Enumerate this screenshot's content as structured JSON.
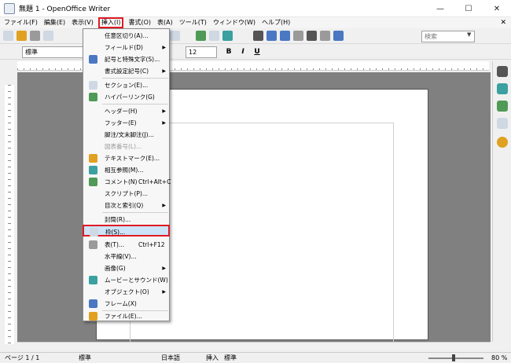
{
  "window": {
    "title": "無題 1 - OpenOffice Writer",
    "minimize": "—",
    "maximize": "☐",
    "close": "✕"
  },
  "menubar": {
    "items": [
      {
        "label": "ファイル(F)"
      },
      {
        "label": "編集(E)"
      },
      {
        "label": "表示(V)"
      },
      {
        "label": "挿入(I)",
        "active": true
      },
      {
        "label": "書式(O)"
      },
      {
        "label": "表(A)"
      },
      {
        "label": "ツール(T)"
      },
      {
        "label": "ウィンドウ(W)"
      },
      {
        "label": "ヘルプ(H)"
      }
    ],
    "close": "✕"
  },
  "toolbar": {
    "search_placeholder": "検索"
  },
  "formatting": {
    "paragraph_style": "標準",
    "font_size": "12",
    "bold": "B",
    "italic": "I",
    "underline": "U"
  },
  "insert_menu": {
    "items": [
      {
        "label": "任意区切り(A)..."
      },
      {
        "label": "フィールド(D)",
        "submenu": true
      },
      {
        "label": "記号と特殊文字(S)...",
        "icon": "special-character-icon"
      },
      {
        "label": "書式設定記号(C)",
        "submenu": true
      },
      {
        "label": "セクション(E)...",
        "icon": "section-icon"
      },
      {
        "label": "ハイパーリンク(G)",
        "icon": "hyperlink-icon"
      },
      {
        "label": "ヘッダー(H)",
        "submenu": true
      },
      {
        "label": "フッター(E)",
        "submenu": true
      },
      {
        "label": "脚注/文末脚注(J)..."
      },
      {
        "label": "図表番号(L)...",
        "disabled": true
      },
      {
        "label": "テキストマーク(E)...",
        "icon": "bookmark-icon"
      },
      {
        "label": "相互参照(M)...",
        "icon": "cross-reference-icon"
      },
      {
        "label": "コメント(N)",
        "shortcut": "Ctrl+Alt+C",
        "icon": "comment-icon"
      },
      {
        "label": "スクリプト(P)..."
      },
      {
        "label": "目次と索引(Q)",
        "submenu": true
      },
      {
        "label": "封筒(R)..."
      },
      {
        "label": "枠(S)...",
        "icon": "frame-icon",
        "selected": true
      },
      {
        "label": "表(T)...",
        "shortcut": "Ctrl+F12",
        "icon": "table-icon"
      },
      {
        "label": "水平線(V)..."
      },
      {
        "label": "画像(G)",
        "submenu": true
      },
      {
        "label": "ムービーとサウンド(W)",
        "icon": "movie-sound-icon"
      },
      {
        "label": "オブジェクト(O)",
        "submenu": true
      },
      {
        "label": "フレーム(X)",
        "icon": "floating-frame-icon"
      },
      {
        "label": "ファイル(E)...",
        "icon": "file-icon"
      }
    ]
  },
  "statusbar": {
    "page": "ページ 1 / 1",
    "style": "標準",
    "language": "日本語",
    "mode": "挿入",
    "selection": "標準",
    "zoom": "80 %"
  },
  "colors": {
    "highlight_border": "#e01b24",
    "selection_bg": "#cce4f7"
  }
}
